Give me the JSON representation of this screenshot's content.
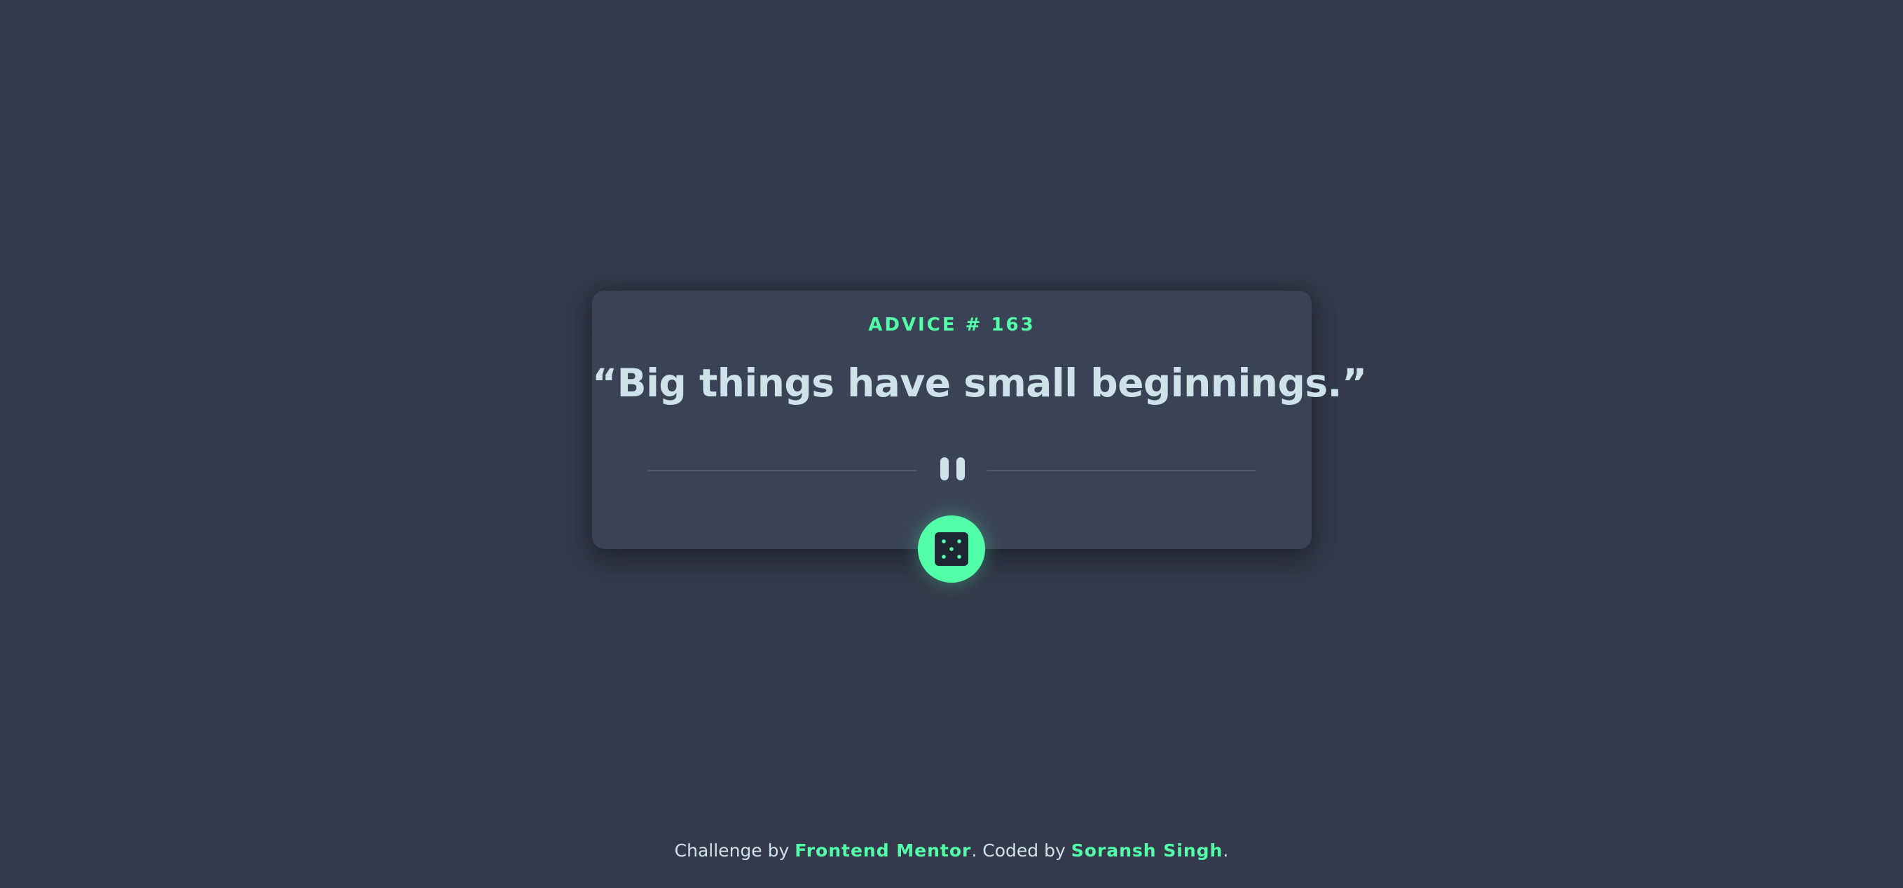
{
  "advice": {
    "id_label": "ADVICE # 163",
    "text": "“Big things have small beginnings.”"
  },
  "footer": {
    "challenge_prefix": "Challenge by ",
    "challenge_link": "Frontend Mentor",
    "coded_prefix": ". Coded by ",
    "author_link": "Soransh Singh",
    "suffix": "."
  },
  "icons": {
    "divider": "pause-divider-icon",
    "dice": "dice-icon"
  },
  "colors": {
    "background": "#343a4b",
    "card": "#3a4356",
    "accent": "#52ffa8",
    "text": "#cee3e9",
    "divider_line": "#4e5d73",
    "dice_face": "#1f2633"
  }
}
